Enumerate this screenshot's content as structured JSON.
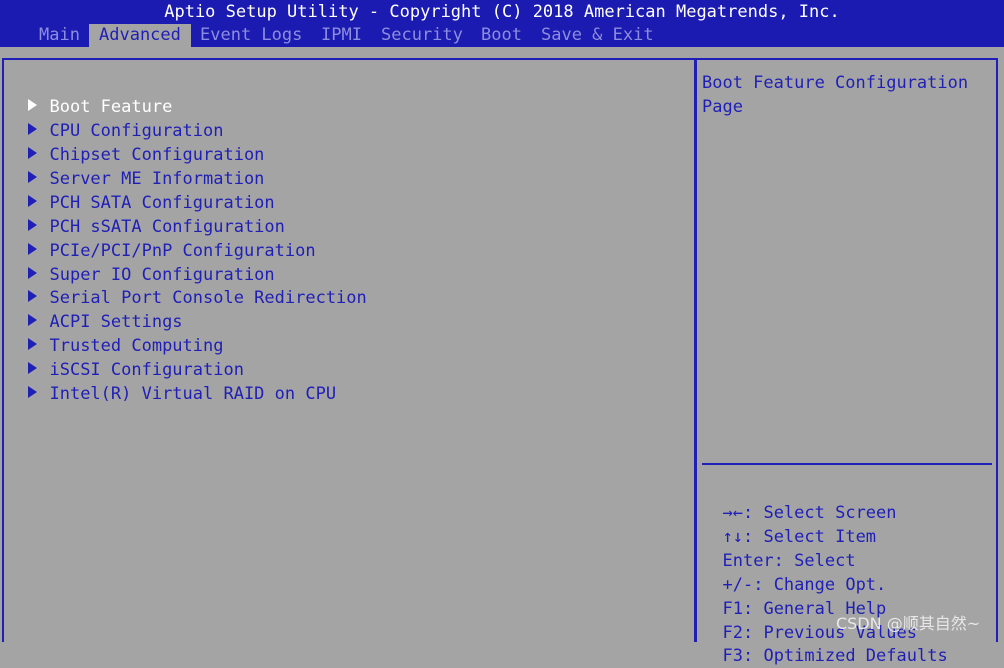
{
  "header": {
    "title": "Aptio Setup Utility - Copyright (C) 2018 American Megatrends, Inc."
  },
  "tabs": [
    {
      "label": "Main",
      "active": false
    },
    {
      "label": "Advanced",
      "active": true
    },
    {
      "label": "Event Logs",
      "active": false
    },
    {
      "label": "IPMI",
      "active": false
    },
    {
      "label": "Security",
      "active": false
    },
    {
      "label": "Boot",
      "active": false
    },
    {
      "label": "Save & Exit",
      "active": false
    }
  ],
  "menu": {
    "items": [
      {
        "label": "Boot Feature",
        "selected": true
      },
      {
        "label": "CPU Configuration"
      },
      {
        "label": "Chipset Configuration"
      },
      {
        "label": "Server ME Information"
      },
      {
        "label": "PCH SATA Configuration"
      },
      {
        "label": "PCH sSATA Configuration"
      },
      {
        "label": "PCIe/PCI/PnP Configuration"
      },
      {
        "label": "Super IO Configuration"
      },
      {
        "label": "Serial Port Console Redirection"
      },
      {
        "label": "ACPI Settings"
      },
      {
        "label": "Trusted Computing"
      },
      {
        "label": "iSCSI Configuration"
      },
      {
        "label": "Intel(R) Virtual RAID on CPU"
      }
    ]
  },
  "help": {
    "lines": [
      "Boot Feature Configuration",
      "Page"
    ]
  },
  "keys": [
    {
      "key": "→←:",
      "action": "Select Screen"
    },
    {
      "key": "↑↓:",
      "action": "Select Item"
    },
    {
      "key": "Enter:",
      "action": "Select"
    },
    {
      "key": "+/-:",
      "action": "Change Opt."
    },
    {
      "key": "F1:",
      "action": "General Help"
    },
    {
      "key": "F2:",
      "action": "Previous Values"
    },
    {
      "key": "F3:",
      "action": "Optimized Defaults"
    }
  ],
  "watermark": "CSDN @顺其自然~",
  "colors": {
    "header_bg": "#1b1bb1",
    "body_bg": "#a4a4a4",
    "text_blue": "#1f1fb7",
    "selected_text": "#ffffff",
    "inactive_tab": "#8d8de0"
  }
}
